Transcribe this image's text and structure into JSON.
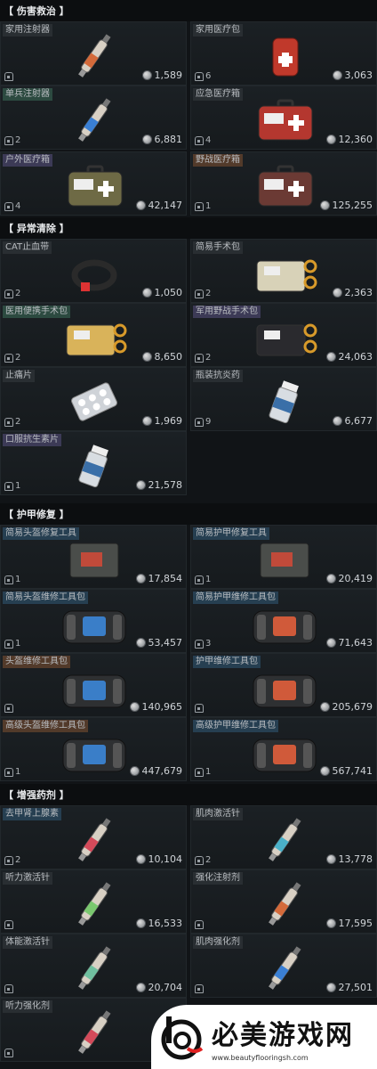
{
  "sections": [
    {
      "title": "【 伤害救治 】"
    },
    {
      "title": "【 异常清除 】"
    },
    {
      "title": "【 护甲修复 】"
    },
    {
      "title": "【 增强药剂 】"
    }
  ],
  "items": [
    {
      "label": "家用注射器",
      "stock": "",
      "price": "1,589",
      "icon": "syringe-icon"
    },
    {
      "label": "家用医疗包",
      "stock": "6",
      "price": "3,063",
      "icon": "medical-pouch-icon"
    },
    {
      "label": "单兵注射器",
      "stock": "2",
      "price": "6,881",
      "icon": "syringe-icon"
    },
    {
      "label": "应急医疗箱",
      "stock": "4",
      "price": "12,360",
      "icon": "medical-case-icon"
    },
    {
      "label": "户外医疗箱",
      "stock": "4",
      "price": "42,147",
      "icon": "medical-case-icon"
    },
    {
      "label": "野战医疗箱",
      "stock": "1",
      "price": "125,255",
      "icon": "medical-case-icon"
    },
    {
      "label": "CAT止血带",
      "stock": "2",
      "price": "1,050",
      "icon": "tourniquet-icon"
    },
    {
      "label": "简易手术包",
      "stock": "2",
      "price": "2,363",
      "icon": "surgery-kit-icon"
    },
    {
      "label": "医用便携手术包",
      "stock": "2",
      "price": "8,650",
      "icon": "surgery-kit-icon"
    },
    {
      "label": "军用野战手术包",
      "stock": "2",
      "price": "24,063",
      "icon": "surgery-kit-icon"
    },
    {
      "label": "止痛片",
      "stock": "2",
      "price": "1,969",
      "icon": "pill-blister-icon"
    },
    {
      "label": "瓶装抗炎药",
      "stock": "9",
      "price": "6,677",
      "icon": "pill-bottle-icon"
    },
    {
      "label": "口服抗生素片",
      "stock": "1",
      "price": "21,578",
      "icon": "pill-bottle-icon"
    },
    {
      "label": "简易头盔修复工具",
      "stock": "1",
      "price": "17,854",
      "icon": "repair-kit-icon"
    },
    {
      "label": "简易护甲修复工具",
      "stock": "1",
      "price": "20,419",
      "icon": "repair-kit-icon"
    },
    {
      "label": "简易头盔维修工具包",
      "stock": "1",
      "price": "53,457",
      "icon": "repair-bag-icon"
    },
    {
      "label": "简易护甲维修工具包",
      "stock": "3",
      "price": "71,643",
      "icon": "repair-bag-icon"
    },
    {
      "label": "头盔维修工具包",
      "stock": "",
      "price": "140,965",
      "icon": "repair-bag-icon"
    },
    {
      "label": "护甲维修工具包",
      "stock": "",
      "price": "205,679",
      "icon": "repair-bag-icon"
    },
    {
      "label": "高级头盔维修工具包",
      "stock": "1",
      "price": "447,679",
      "icon": "repair-bag-icon"
    },
    {
      "label": "高级护甲维修工具包",
      "stock": "1",
      "price": "567,741",
      "icon": "repair-bag-icon"
    },
    {
      "label": "去甲肾上腺素",
      "stock": "2",
      "price": "10,104",
      "icon": "injector-icon"
    },
    {
      "label": "肌肉激活针",
      "stock": "2",
      "price": "13,778",
      "icon": "injector-icon"
    },
    {
      "label": "听力激活针",
      "stock": "",
      "price": "16,533",
      "icon": "injector-icon"
    },
    {
      "label": "强化注射剂",
      "stock": "",
      "price": "17,595",
      "icon": "injector-icon"
    },
    {
      "label": "体能激活针",
      "stock": "",
      "price": "20,704",
      "icon": "injector-icon"
    },
    {
      "label": "肌肉强化剂",
      "stock": "",
      "price": "27,501",
      "icon": "injector-icon"
    },
    {
      "label": "听力强化剂",
      "stock": "",
      "price": "",
      "icon": "injector-icon"
    }
  ],
  "watermark": {
    "title": "必美游戏网",
    "url": "www.beautyflooringsh.com"
  },
  "colors": {
    "background": "#111417",
    "cell": "#1b2024",
    "text": "#c8ccd0"
  }
}
